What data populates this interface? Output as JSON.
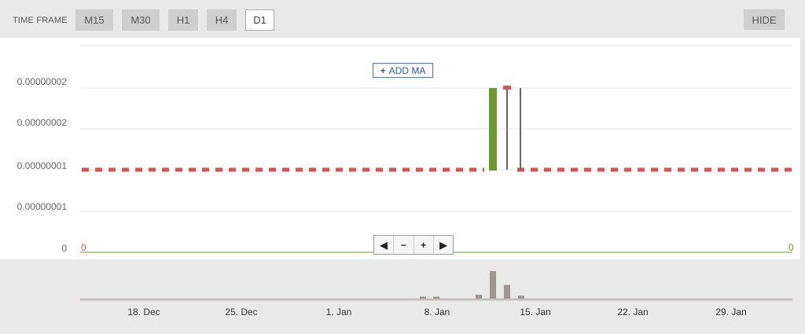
{
  "toolbar": {
    "label": "TIME FRAME",
    "timeframes": [
      "M15",
      "M30",
      "H1",
      "H4",
      "D1"
    ],
    "active": "D1",
    "hide_label": "HIDE"
  },
  "add_ma_label": "ADD MA",
  "zoom_controls": [
    "◀",
    "−",
    "+",
    "▶"
  ],
  "chart_data": {
    "type": "candlestick",
    "y_tick_labels": [
      "0.00000002",
      "0.00000002",
      "0.00000001",
      "0.00000001",
      "0"
    ],
    "x_tick_labels": [
      "18. Dec",
      "25. Dec",
      "1. Jan",
      "8. Jan",
      "15. Jan",
      "22. Jan",
      "29. Jan"
    ],
    "zero_left_label": "0",
    "zero_right_label": "0",
    "price_line_level": 1e-08,
    "colors": {
      "price_line": "#d9534f",
      "up_candle": "#6a9a2e",
      "wick": "#666666",
      "zero_line": "#6a9a2e",
      "volume": "#9e9696"
    },
    "candles": [
      {
        "date": "11. Jan",
        "open": 1e-08,
        "close": 2e-08,
        "high": 2e-08,
        "low": 1e-08,
        "color": "up"
      },
      {
        "date": "12. Jan",
        "open": 2e-08,
        "close": 2e-08,
        "high": 2e-08,
        "low": 1e-08,
        "color": "down"
      },
      {
        "date": "13. Jan",
        "open": 2e-08,
        "close": 1e-08,
        "high": 2e-08,
        "low": 1e-08,
        "color": "wick"
      }
    ],
    "volume": [
      {
        "date": "7. Jan",
        "value": 1
      },
      {
        "date": "8. Jan",
        "value": 1
      },
      {
        "date": "10. Jan",
        "value": 2
      },
      {
        "date": "11. Jan",
        "value": 14
      },
      {
        "date": "12. Jan",
        "value": 7
      },
      {
        "date": "13. Jan",
        "value": 1.5
      }
    ]
  }
}
